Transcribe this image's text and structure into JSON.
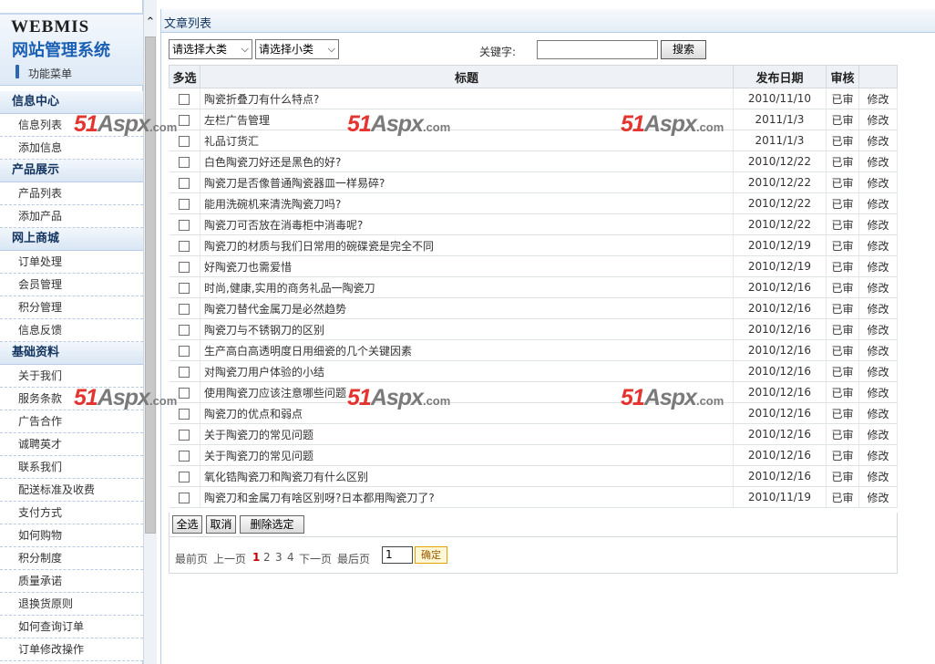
{
  "sidebar": {
    "logo_en": "WEBMIS",
    "logo_cn": "网站管理系统",
    "menu_label": "功能菜单",
    "groups": [
      {
        "label": "信息中心",
        "items": [
          "信息列表",
          "添加信息"
        ]
      },
      {
        "label": "产品展示",
        "items": [
          "产品列表",
          "添加产品"
        ]
      },
      {
        "label": "网上商城",
        "items": [
          "订单处理",
          "会员管理",
          "积分管理",
          "信息反馈"
        ]
      },
      {
        "label": "基础资料",
        "items": [
          "关于我们",
          "服务条款",
          "广告合作",
          "诚聘英才",
          "联系我们",
          "配送标准及收费",
          "支付方式",
          "如何购物",
          "积分制度",
          "质量承诺",
          "退换货原则",
          "如何查询订单",
          "订单修改操作"
        ]
      }
    ]
  },
  "main": {
    "title": "文章列表",
    "filters": {
      "category_select": "请选择大类",
      "subcategory_select": "请选择小类",
      "keyword_label": "关键字:",
      "keyword_value": "",
      "search_label": "搜索"
    },
    "table": {
      "headers": [
        "多选",
        "标题",
        "发布日期",
        "审核",
        ""
      ],
      "rows": [
        {
          "title": "陶瓷折叠刀有什么特点?",
          "date": "2010/11/10",
          "audit": "已审",
          "edit": "修改"
        },
        {
          "title": "左栏广告管理",
          "date": "2011/1/3",
          "audit": "已审",
          "edit": "修改"
        },
        {
          "title": "礼品订货汇",
          "date": "2011/1/3",
          "audit": "已审",
          "edit": "修改"
        },
        {
          "title": "白色陶瓷刀好还是黑色的好?",
          "date": "2010/12/22",
          "audit": "已审",
          "edit": "修改"
        },
        {
          "title": "陶瓷刀是否像普通陶瓷器皿一样易碎?",
          "date": "2010/12/22",
          "audit": "已审",
          "edit": "修改"
        },
        {
          "title": "能用洗碗机来清洗陶瓷刀吗?",
          "date": "2010/12/22",
          "audit": "已审",
          "edit": "修改"
        },
        {
          "title": "陶瓷刀可否放在消毒柜中消毒呢?",
          "date": "2010/12/22",
          "audit": "已审",
          "edit": "修改"
        },
        {
          "title": "陶瓷刀的材质与我们日常用的碗碟瓷是完全不同",
          "date": "2010/12/19",
          "audit": "已审",
          "edit": "修改"
        },
        {
          "title": "好陶瓷刀也需爱惜",
          "date": "2010/12/19",
          "audit": "已审",
          "edit": "修改"
        },
        {
          "title": "时尚,健康,实用的商务礼品一陶瓷刀",
          "date": "2010/12/16",
          "audit": "已审",
          "edit": "修改"
        },
        {
          "title": "陶瓷刀替代金属刀是必然趋势",
          "date": "2010/12/16",
          "audit": "已审",
          "edit": "修改"
        },
        {
          "title": "陶瓷刀与不锈钢刀的区别",
          "date": "2010/12/16",
          "audit": "已审",
          "edit": "修改"
        },
        {
          "title": "生产高白高透明度日用细瓷的几个关键因素",
          "date": "2010/12/16",
          "audit": "已审",
          "edit": "修改"
        },
        {
          "title": "对陶瓷刀用户体验的小结",
          "date": "2010/12/16",
          "audit": "已审",
          "edit": "修改"
        },
        {
          "title": "使用陶瓷刀应该注意哪些问题",
          "date": "2010/12/16",
          "audit": "已审",
          "edit": "修改"
        },
        {
          "title": "陶瓷刀的优点和弱点",
          "date": "2010/12/16",
          "audit": "已审",
          "edit": "修改"
        },
        {
          "title": "关于陶瓷刀的常见问题",
          "date": "2010/12/16",
          "audit": "已审",
          "edit": "修改"
        },
        {
          "title": "关于陶瓷刀的常见问题",
          "date": "2010/12/16",
          "audit": "已审",
          "edit": "修改"
        },
        {
          "title": "氧化锆陶瓷刀和陶瓷刀有什么区别",
          "date": "2010/12/16",
          "audit": "已审",
          "edit": "修改"
        },
        {
          "title": "陶瓷刀和金属刀有啥区别呀?日本都用陶瓷刀了?",
          "date": "2010/11/19",
          "audit": "已审",
          "edit": "修改"
        }
      ]
    },
    "actions": {
      "select_all": "全选",
      "cancel": "取消",
      "delete_selected": "删除选定"
    },
    "pager": {
      "first": "最前页",
      "prev": "上一页",
      "pages": [
        "1",
        "2",
        "3",
        "4"
      ],
      "current": "1",
      "next": "下一页",
      "last": "最后页",
      "page_input": "1",
      "confirm": "确定"
    }
  },
  "watermark": {
    "brand": "51",
    "name": "Aspx",
    "domain": ".com"
  },
  "colors": {
    "accent": "#1a5fb4",
    "watermark_red": "#e3342f",
    "current_page": "#c00000"
  }
}
